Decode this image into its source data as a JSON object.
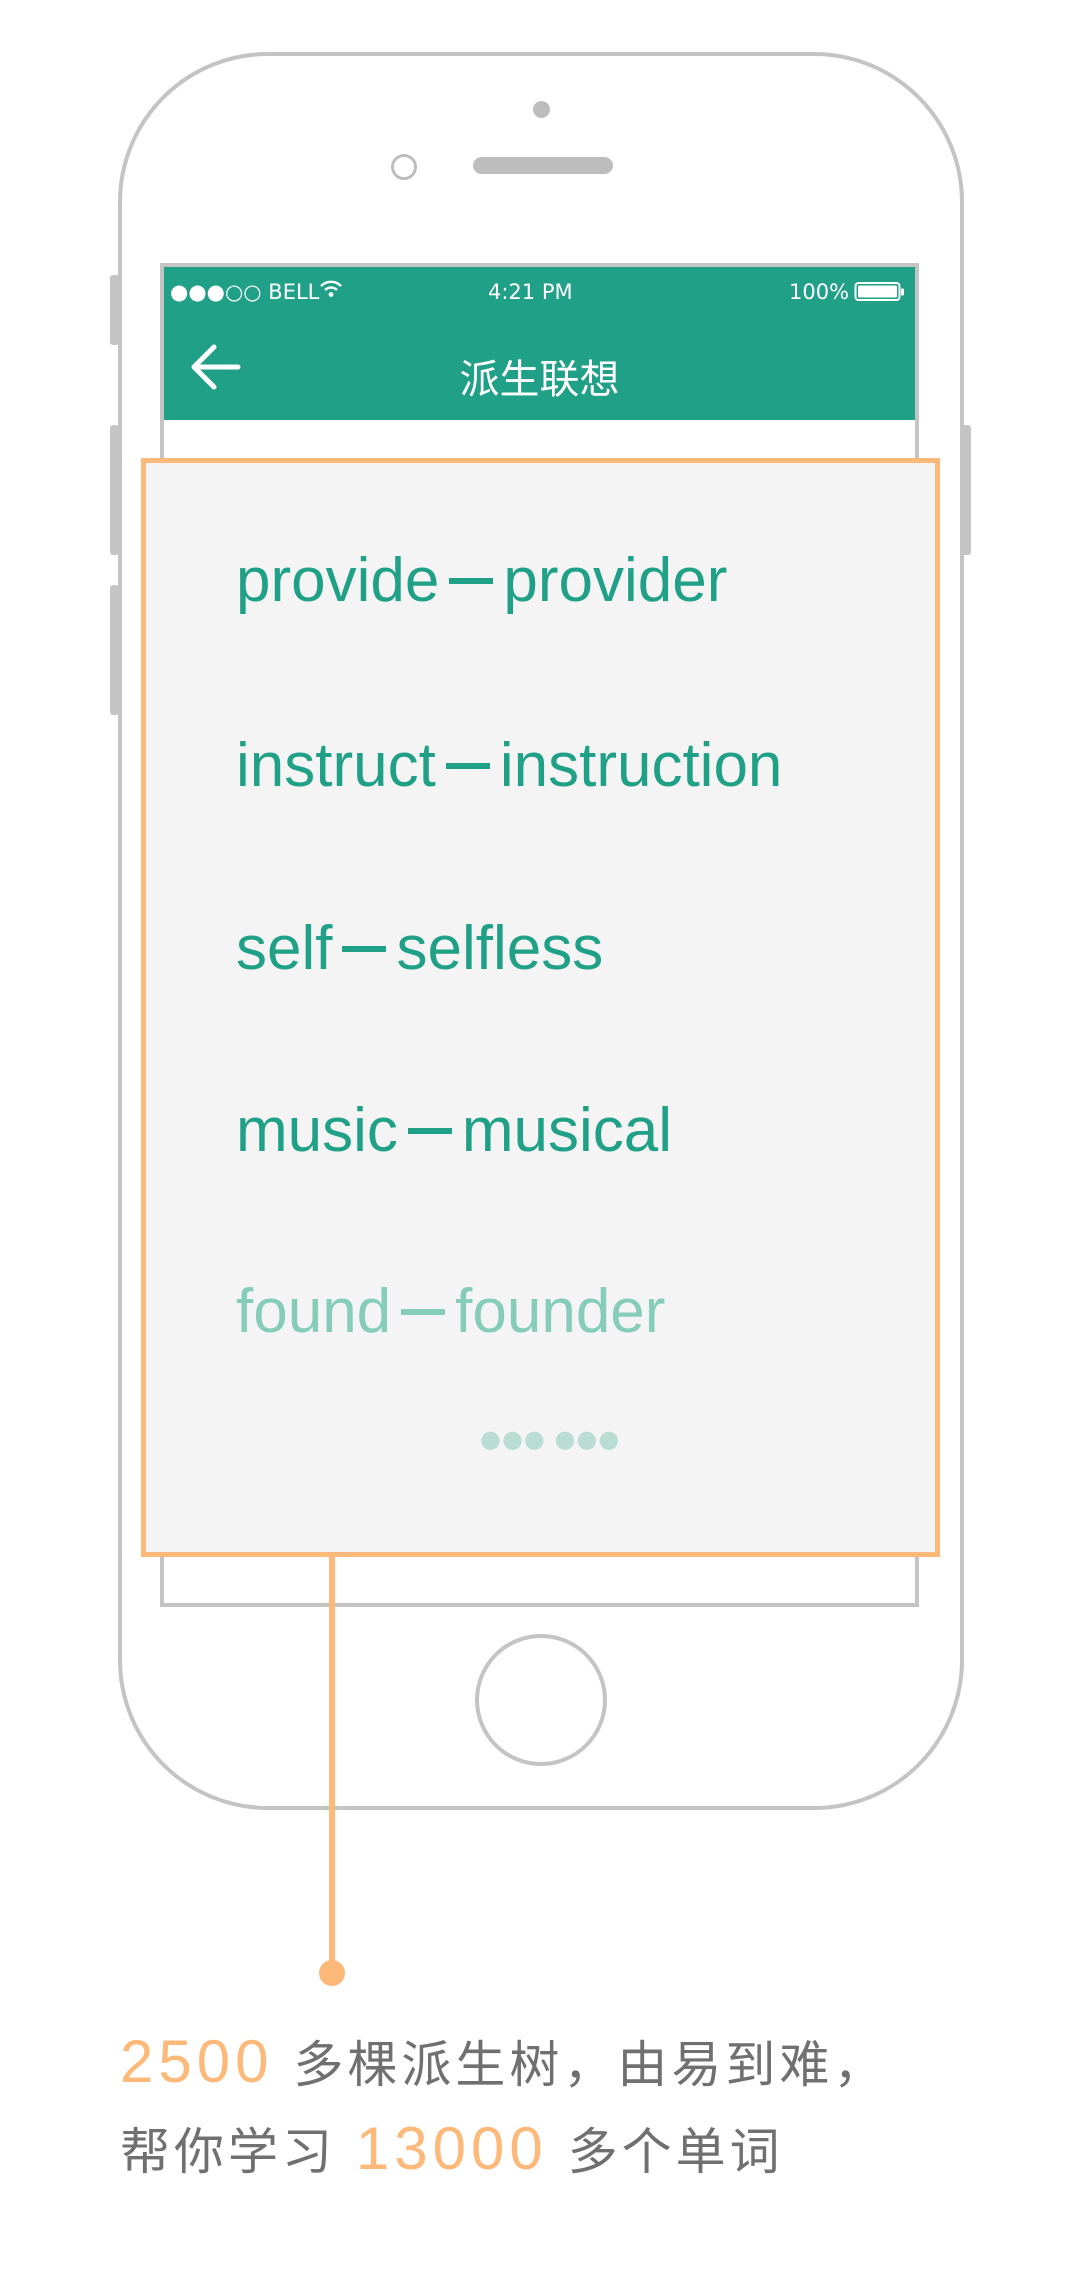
{
  "status_bar": {
    "carrier": "●●●○○ BELL",
    "time": "4:21 PM",
    "battery": "100%"
  },
  "nav": {
    "title": "派生联想"
  },
  "words": [
    {
      "base": "provide",
      "derived": "provider"
    },
    {
      "base": "instruct",
      "derived": "instruction"
    },
    {
      "base": "self",
      "derived": "selfless"
    },
    {
      "base": "music",
      "derived": "musical"
    },
    {
      "base": "found",
      "derived": "founder"
    }
  ],
  "more_indicator": "●●● ●●●",
  "caption": {
    "line1_num": "2500",
    "line1_text": "多棵派生树，由易到难，",
    "line2_pre": "帮你学习",
    "line2_num": "13000",
    "line2_text": "多个单词"
  },
  "colors": {
    "accent_green": "#20a086",
    "highlight_orange": "#fdb97a"
  }
}
